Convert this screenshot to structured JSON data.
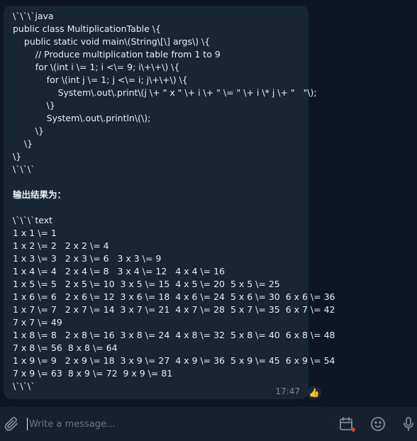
{
  "message": {
    "lines": [
      "\\`\\`\\`java",
      "public class MultiplicationTable \\{",
      "    public static void main\\(String\\[\\] args\\) \\{",
      "        // Produce multiplication table from 1 to 9",
      "        for \\(int i \\= 1; i <\\= 9; i\\+\\+\\) \\{",
      "            for \\(int j \\= 1; j <\\= i; j\\+\\+\\) \\{",
      "                System\\.out\\.print\\(j \\+ \" x \" \\+ i \\+ \" \\= \" \\+ i \\* j \\+ \"   \"\\);",
      "            \\}",
      "            System\\.out\\.println\\(\\);",
      "        \\}",
      "    \\}",
      "\\}",
      "\\`\\`\\`",
      "",
      "输出结果为：",
      "",
      "\\`\\`\\`text",
      "1 x 1 \\= 1",
      "1 x 2 \\= 2   2 x 2 \\= 4",
      "1 x 3 \\= 3   2 x 3 \\= 6   3 x 3 \\= 9",
      "1 x 4 \\= 4   2 x 4 \\= 8   3 x 4 \\= 12   4 x 4 \\= 16",
      "1 x 5 \\= 5   2 x 5 \\= 10  3 x 5 \\= 15  4 x 5 \\= 20  5 x 5 \\= 25",
      "1 x 6 \\= 6   2 x 6 \\= 12  3 x 6 \\= 18  4 x 6 \\= 24  5 x 6 \\= 30  6 x 6 \\= 36",
      "1 x 7 \\= 7   2 x 7 \\= 14  3 x 7 \\= 21  4 x 7 \\= 28  5 x 7 \\= 35  6 x 7 \\= 42",
      "7 x 7 \\= 49",
      "1 x 8 \\= 8   2 x 8 \\= 16  3 x 8 \\= 24  4 x 8 \\= 32  5 x 8 \\= 40  6 x 8 \\= 48",
      "7 x 8 \\= 56  8 x 8 \\= 64",
      "1 x 9 \\= 9   2 x 9 \\= 18  3 x 9 \\= 27  4 x 9 \\= 36  5 x 9 \\= 45  6 x 9 \\= 54",
      "7 x 9 \\= 63  8 x 9 \\= 72  9 x 9 \\= 81",
      "\\`\\`\\`"
    ],
    "time": "17:47",
    "reaction_icon": "thumbs-up-icon",
    "reaction_emoji": "👍"
  },
  "composer": {
    "placeholder": "Write a message..."
  },
  "icons": {
    "attach": "paperclip-icon",
    "schedule": "calendar-icon",
    "emoji": "smile-icon",
    "voice": "microphone-icon"
  },
  "colors": {
    "background": "#0e1621",
    "bubble": "#182533",
    "composer": "#17212b",
    "icon": "#7d8b99",
    "notification_dot": "#e53935"
  }
}
